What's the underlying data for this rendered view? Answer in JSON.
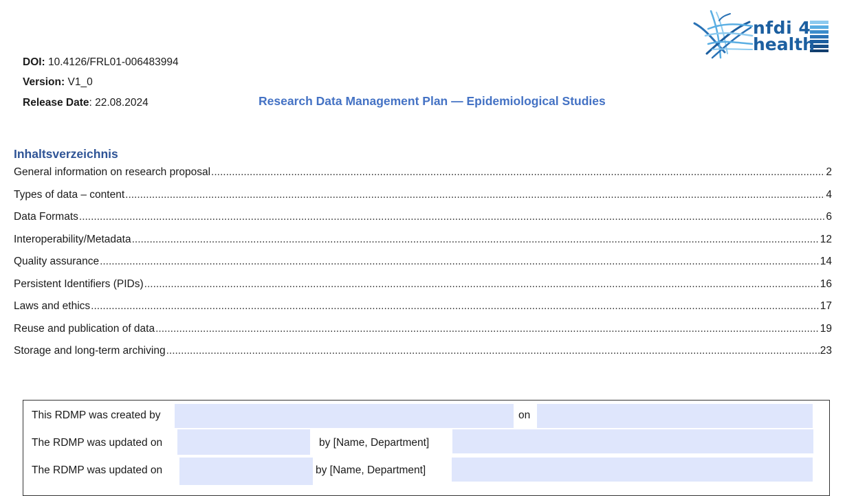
{
  "header": {
    "doi_label": "DOI:",
    "doi_value": "10.4126/FRL01-006483994",
    "version_label": "Version:",
    "version_value": "V1_0",
    "release_label": "Release Date",
    "release_value": ": 22.08.2024",
    "title": "Research Data Management Plan — Epidemiological Studies"
  },
  "logo": {
    "line1": "nfdi 4",
    "line2": "health",
    "brand_colors": [
      "#2a72b5",
      "#5aaee3",
      "#1c5fa0"
    ]
  },
  "toc": {
    "heading": "Inhaltsverzeichnis",
    "entries": [
      {
        "title": "General information on research proposal",
        "page": "2"
      },
      {
        "title": "Types of data – content",
        "page": "4"
      },
      {
        "title": "Data Formats",
        "page": "6"
      },
      {
        "title": "Interoperability/Metadata",
        "page": "12"
      },
      {
        "title": "Quality assurance",
        "page": "14"
      },
      {
        "title": "Persistent Identifiers (PIDs)",
        "page": "16"
      },
      {
        "title": "Laws and ethics",
        "page": "17"
      },
      {
        "title": "Reuse and publication of data",
        "page": "19"
      },
      {
        "title": "Storage and long-term archiving",
        "page": "23"
      }
    ]
  },
  "form": {
    "created_by_label": "This RDMP was created by",
    "on_label": "on",
    "updated_on_label_1": "The RDMP was updated on",
    "by_label_1": "by [Name, Department]",
    "updated_on_label_2": "The RDMP was updated on",
    "by_label_2": "by [Name, Department]",
    "field_color": "#dfe6fc"
  }
}
